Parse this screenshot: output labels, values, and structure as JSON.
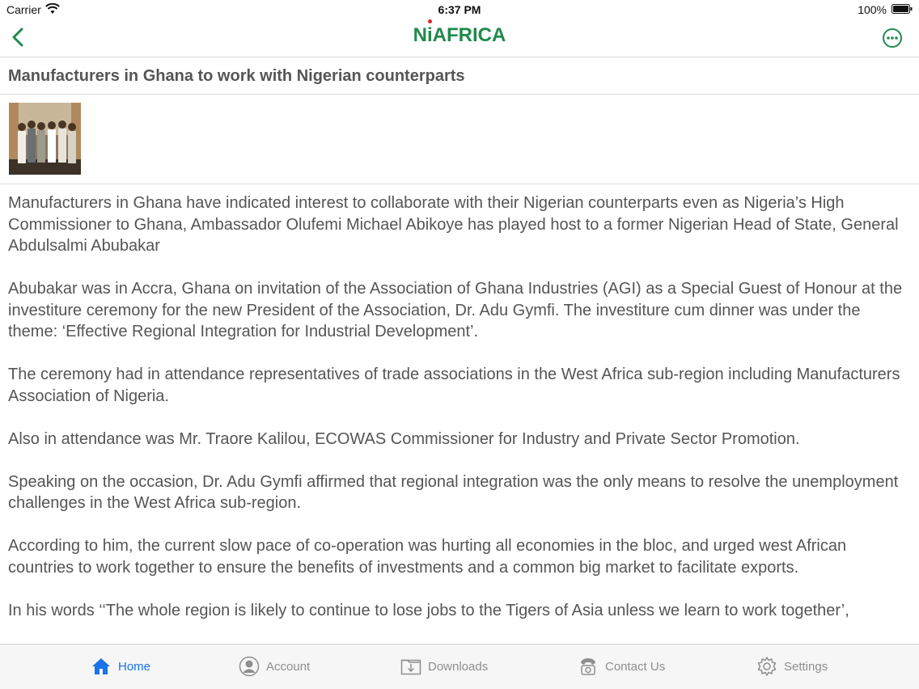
{
  "status_bar": {
    "carrier": "Carrier",
    "time": "6:37 PM",
    "battery_percent": "100%"
  },
  "nav": {
    "logo_text_n": "N",
    "logo_text_i": "i",
    "logo_text_rest": "AFRICA"
  },
  "article": {
    "title": "Manufacturers in Ghana to work with Nigerian counterparts",
    "paragraphs": [
      "Manufacturers in Ghana have indicated interest to collaborate with their Nigerian counterparts even as Nigeria’s High Commissioner to Ghana, Ambassador Olufemi Michael Abikoye has played host to a former Nigerian Head of State, General Abdulsalmi Abubakar",
      "Abubakar was in Accra, Ghana on invitation of the Association of Ghana Industries (AGI) as a Special Guest of Honour at the investiture ceremony for the new President of the Association, Dr. Adu Gymfi. The investiture cum dinner was under the theme: ‘Effective Regional Integration for Industrial Development’.",
      "The ceremony had in attendance representatives of trade associations in the West Africa sub-region including Manufacturers Association of Nigeria.",
      "Also in attendance was Mr. Traore Kalilou, ECOWAS Commissioner for Industry and Private Sector Promotion.",
      "Speaking on the occasion, Dr. Adu Gymfi affirmed that regional integration was the only means to resolve the unemployment challenges in the West Africa sub-region.",
      "According to him, the current slow pace of co-operation was hurting all economies in the bloc, and urged west African countries to work together to ensure the benefits of investments and a common big market to facilitate exports.",
      "In his words ‘‘The whole region is likely to continue to lose jobs to the Tigers of Asia unless we learn to work together’,"
    ]
  },
  "tabs": [
    {
      "label": "Home",
      "icon": "home-icon",
      "active": true
    },
    {
      "label": "Account",
      "icon": "account-icon",
      "active": false
    },
    {
      "label": "Downloads",
      "icon": "downloads-icon",
      "active": false
    },
    {
      "label": "Contact Us",
      "icon": "phone-icon",
      "active": false
    },
    {
      "label": "Settings",
      "icon": "gear-icon",
      "active": false
    }
  ],
  "colors": {
    "brand_green": "#1f8a4c",
    "tab_active": "#1a73e8",
    "tab_inactive": "#8e8e8e",
    "text": "#555555"
  }
}
